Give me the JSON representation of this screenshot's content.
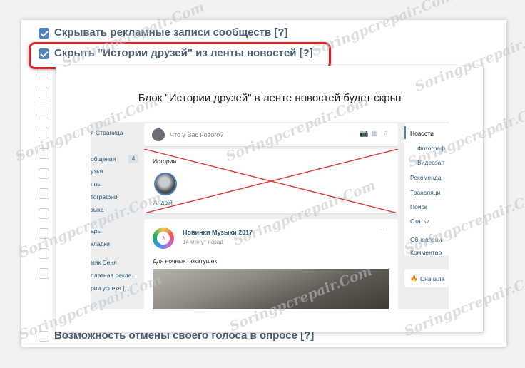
{
  "settings": {
    "options": [
      {
        "label": "Скрывать рекламные записи сообществ",
        "help": "[?]",
        "checked": true
      },
      {
        "label": "Скрыть \"Истории друзей\" из ленты новостей",
        "help": "[?]",
        "checked": true
      },
      {
        "label": "Возможность отмены своего голоса в опросе",
        "help": "[?]",
        "checked": false
      }
    ]
  },
  "tooltip": {
    "title": "Блок \"Истории друзей\" в ленте новостей будет скрыт"
  },
  "vk": {
    "left_menu": [
      "я Страница",
      "общения",
      "узья",
      "ппы",
      "тографии",
      "зыка",
      "ары",
      "кладки",
      "мяк Сеня",
      "платная рекла...",
      "рии успеха |..."
    ],
    "messages_badge": "4",
    "composer_placeholder": "Что у Вас нового?",
    "stories_label": "Истории",
    "story_user": "Андрій",
    "post_author": "Новинки Музыки 2017",
    "post_time": "14 минут назад",
    "post_text": "Для ночных покатушек",
    "post_more": "···",
    "right_menu": [
      "Новости",
      "Фотограф",
      "Видеозап",
      "Рекоменда",
      "Трансляци",
      "Поиск",
      "Статьи",
      "Обновлени",
      "Комментар",
      "Сначала"
    ]
  },
  "watermark": "Soringpcrepair.Com",
  "colors": {
    "accent": "#5181b8",
    "highlight": "#d9252b",
    "cross": "#d94040"
  }
}
